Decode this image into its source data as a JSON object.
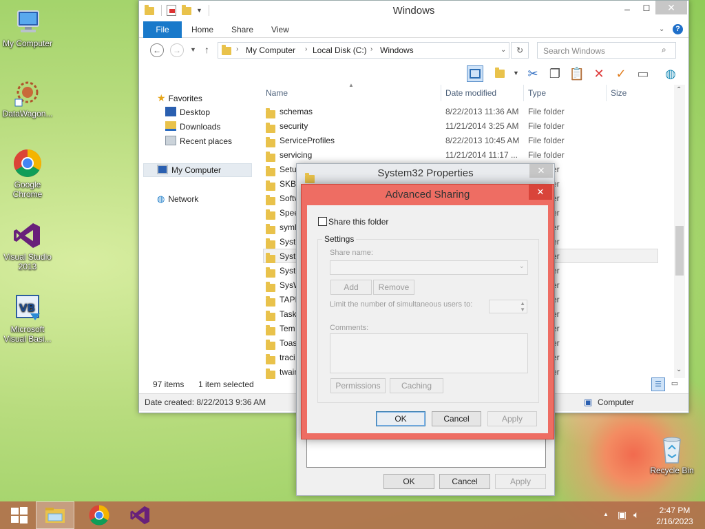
{
  "desktop": {
    "icons": [
      {
        "label": "My Computer",
        "icon": "my-computer-icon"
      },
      {
        "label": "DataWagon...",
        "icon": "datawagon-icon"
      },
      {
        "label": "Google Chrome",
        "icon": "chrome-icon"
      },
      {
        "label": "Visual Studio 2013",
        "icon": "visual-studio-icon"
      },
      {
        "label": "Microsoft Visual Basi...",
        "icon": "visual-basic-icon"
      },
      {
        "label": "Recycle Bin",
        "icon": "recycle-bin-icon"
      }
    ]
  },
  "explorer": {
    "title": "Windows",
    "tabs": [
      "File",
      "Home",
      "Share",
      "View"
    ],
    "breadcrumb": [
      "My Computer",
      "Local Disk (C:)",
      "Windows"
    ],
    "search_placeholder": "Search Windows",
    "nav": {
      "favorites": "Favorites",
      "favorites_items": [
        "Desktop",
        "Downloads",
        "Recent places"
      ],
      "my_computer": "My Computer",
      "network": "Network"
    },
    "columns": {
      "name": "Name",
      "date": "Date modified",
      "type": "Type",
      "size": "Size"
    },
    "rows": [
      {
        "name": "schemas",
        "date": "8/22/2013 11:36 AM",
        "type": "File folder"
      },
      {
        "name": "security",
        "date": "11/21/2014 3:25 AM",
        "type": "File folder"
      },
      {
        "name": "ServiceProfiles",
        "date": "8/22/2013 10:45 AM",
        "type": "File folder"
      },
      {
        "name": "servicing",
        "date": "11/21/2014 11:17 ...",
        "type": "File folder"
      },
      {
        "name": "Setu",
        "date": "",
        "type": "er"
      },
      {
        "name": "SKB",
        "date": "",
        "type": "er"
      },
      {
        "name": "Softv",
        "date": "",
        "type": "er"
      },
      {
        "name": "Spee",
        "date": "",
        "type": "er"
      },
      {
        "name": "syml",
        "date": "",
        "type": "er"
      },
      {
        "name": "Syste",
        "date": "",
        "type": "er"
      },
      {
        "name": "Syste",
        "date": "",
        "type": "er"
      },
      {
        "name": "Syste",
        "date": "",
        "type": "er"
      },
      {
        "name": "SysW",
        "date": "",
        "type": "er"
      },
      {
        "name": "TAPI",
        "date": "",
        "type": "er"
      },
      {
        "name": "Task",
        "date": "",
        "type": "er"
      },
      {
        "name": "Tem",
        "date": "",
        "type": "er"
      },
      {
        "name": "Toas",
        "date": "",
        "type": "er"
      },
      {
        "name": "traci",
        "date": "",
        "type": "er"
      },
      {
        "name": "twain",
        "date": "",
        "type": "er"
      }
    ],
    "status": {
      "items": "97 items",
      "selected": "1 item selected",
      "date_created": "Date created: 8/22/2013 9:36 AM",
      "location": "Computer"
    }
  },
  "props_dialog": {
    "title": "System32 Properties",
    "ok": "OK",
    "cancel": "Cancel",
    "apply": "Apply"
  },
  "adv_sharing": {
    "title": "Advanced Sharing",
    "share_checkbox": "Share this folder",
    "share_checked": false,
    "settings": "Settings",
    "share_name_label": "Share name:",
    "add": "Add",
    "remove": "Remove",
    "limit_label": "Limit the number of simultaneous users to:",
    "comments_label": "Comments:",
    "permissions": "Permissions",
    "caching": "Caching",
    "ok": "OK",
    "cancel": "Cancel",
    "apply": "Apply"
  },
  "taskbar": {
    "time": "2:47 PM",
    "date": "2/16/2023"
  }
}
